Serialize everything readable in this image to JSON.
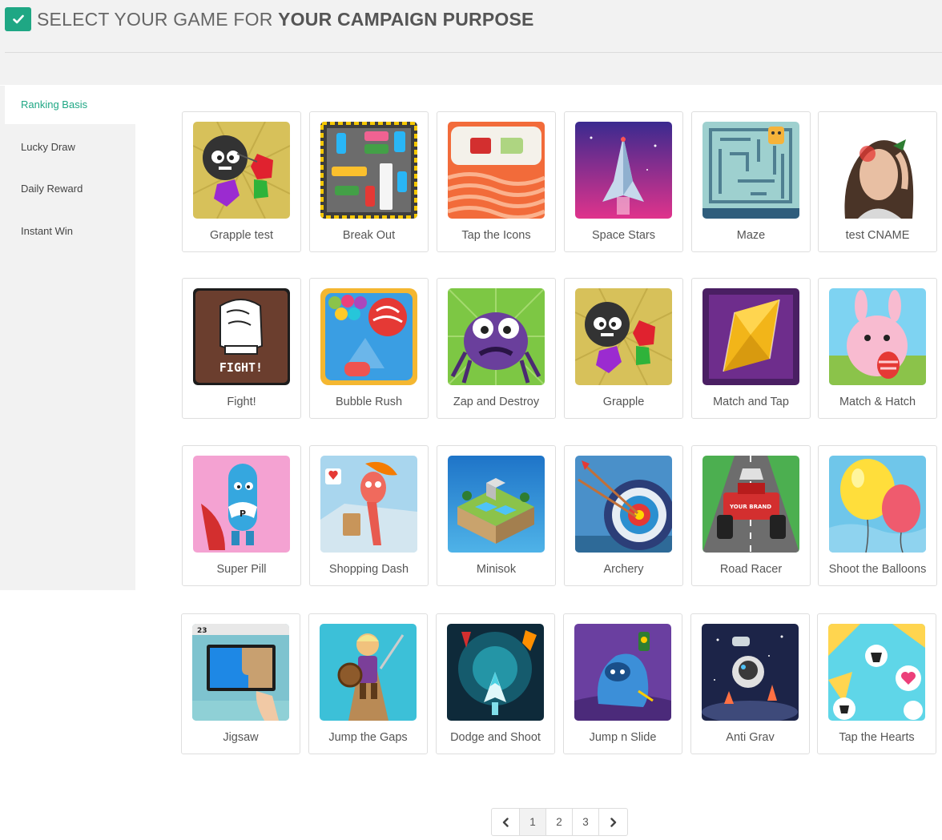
{
  "header": {
    "title_prefix": "SELECT YOUR GAME FOR ",
    "title_emphasis": "YOUR CAMPAIGN PURPOSE",
    "badge_icon": "check-icon",
    "accent_color": "#1fa784"
  },
  "tabs": [
    {
      "label": "Ranking Basis",
      "active": true
    },
    {
      "label": "Lucky Draw"
    },
    {
      "label": "Daily Reward"
    },
    {
      "label": "Instant Win"
    }
  ],
  "games": [
    {
      "label": "Grapple test"
    },
    {
      "label": "Break Out"
    },
    {
      "label": "Tap the Icons"
    },
    {
      "label": "Space Stars"
    },
    {
      "label": "Maze"
    },
    {
      "label": "test CNAME"
    },
    {
      "label": "Fight!",
      "thumb_text": "FIGHT!"
    },
    {
      "label": "Bubble Rush"
    },
    {
      "label": "Zap and Destroy"
    },
    {
      "label": "Grapple"
    },
    {
      "label": "Match and Tap"
    },
    {
      "label": "Match & Hatch"
    },
    {
      "label": "Super Pill"
    },
    {
      "label": "Shopping Dash"
    },
    {
      "label": "Minisok"
    },
    {
      "label": "Archery"
    },
    {
      "label": "Road Racer",
      "thumb_text": "YOUR BRAND"
    },
    {
      "label": "Shoot the Balloons"
    },
    {
      "label": "Jigsaw",
      "thumb_text": "23"
    },
    {
      "label": "Jump the Gaps"
    },
    {
      "label": "Dodge and Shoot"
    },
    {
      "label": "Jump n Slide"
    },
    {
      "label": "Anti Grav"
    },
    {
      "label": "Tap the Hearts"
    }
  ],
  "pagination": {
    "prev_icon": "chevron-left-icon",
    "next_icon": "chevron-right-icon",
    "pages": [
      "1",
      "2",
      "3"
    ],
    "current": "1"
  }
}
